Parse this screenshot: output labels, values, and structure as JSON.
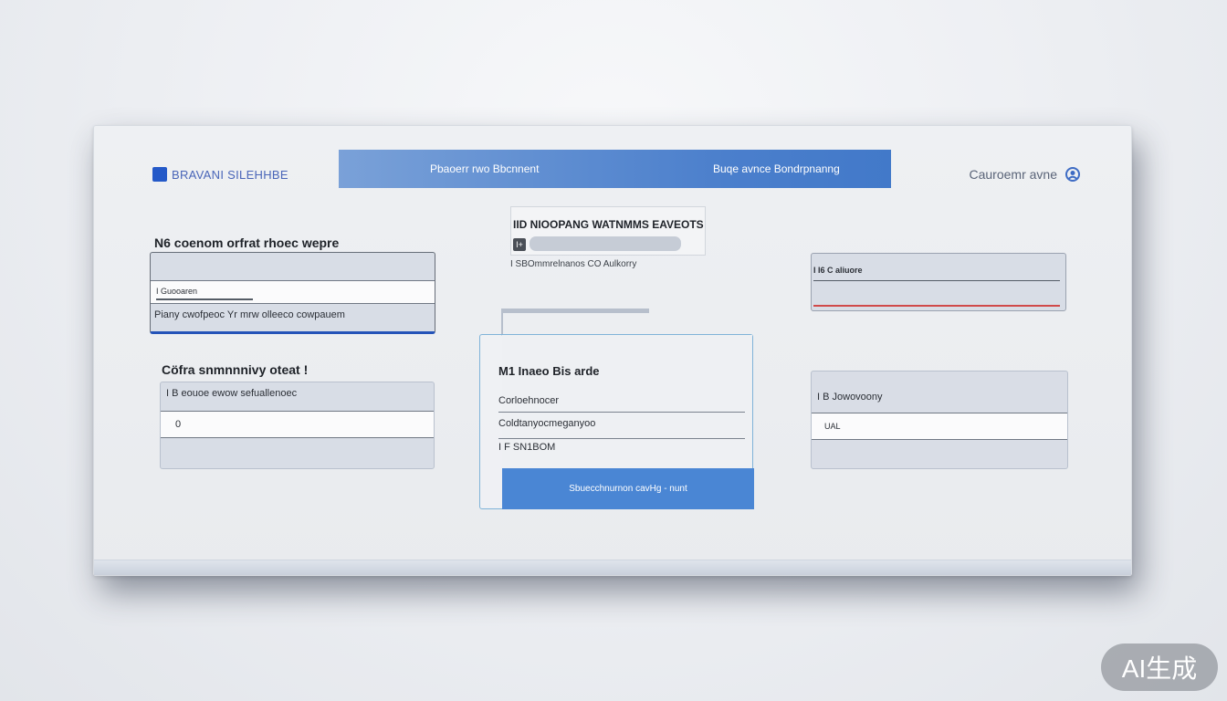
{
  "header": {
    "brand": "BRAVANI SILEHHBE",
    "nav_tabs": [
      "Pbaoerr rwo Bbcnnent",
      "Buqe avnce Bondrpnanng"
    ],
    "user_name": "Cauroemr avne",
    "accent": "#4279c9"
  },
  "left_top": {
    "label": "N6 coenom orfrat rhoec wepre",
    "field_value": "I Guooaren",
    "hint": "Piany cwofpeoc Yr mrw olleeco cowpauem"
  },
  "left_bottom": {
    "label": "Cöfra snmnnnivy oteat !",
    "header_row": "I B eouoe ewow sefuallenoec",
    "value": "0"
  },
  "middle": {
    "title": "IID NIOOPANG WATNMMS EAVEOTS",
    "chip": "I+",
    "subtext": "I SBOmmrelnanos CO Aulkorry"
  },
  "modal": {
    "title": "M1 Inaeo Bis arde",
    "fields": [
      "Corloehnocer",
      "Coldtanyocmeganyoo",
      "I F SN1BOM"
    ],
    "button_label": "Sbuecchnurnon cavHg - nunt"
  },
  "right_top": {
    "label": "I I6 C aliuore",
    "error_color": "#d04a4a"
  },
  "right_bottom": {
    "header_row": "I B Jowovoony",
    "value": "UAL"
  },
  "watermark": "AI生成"
}
